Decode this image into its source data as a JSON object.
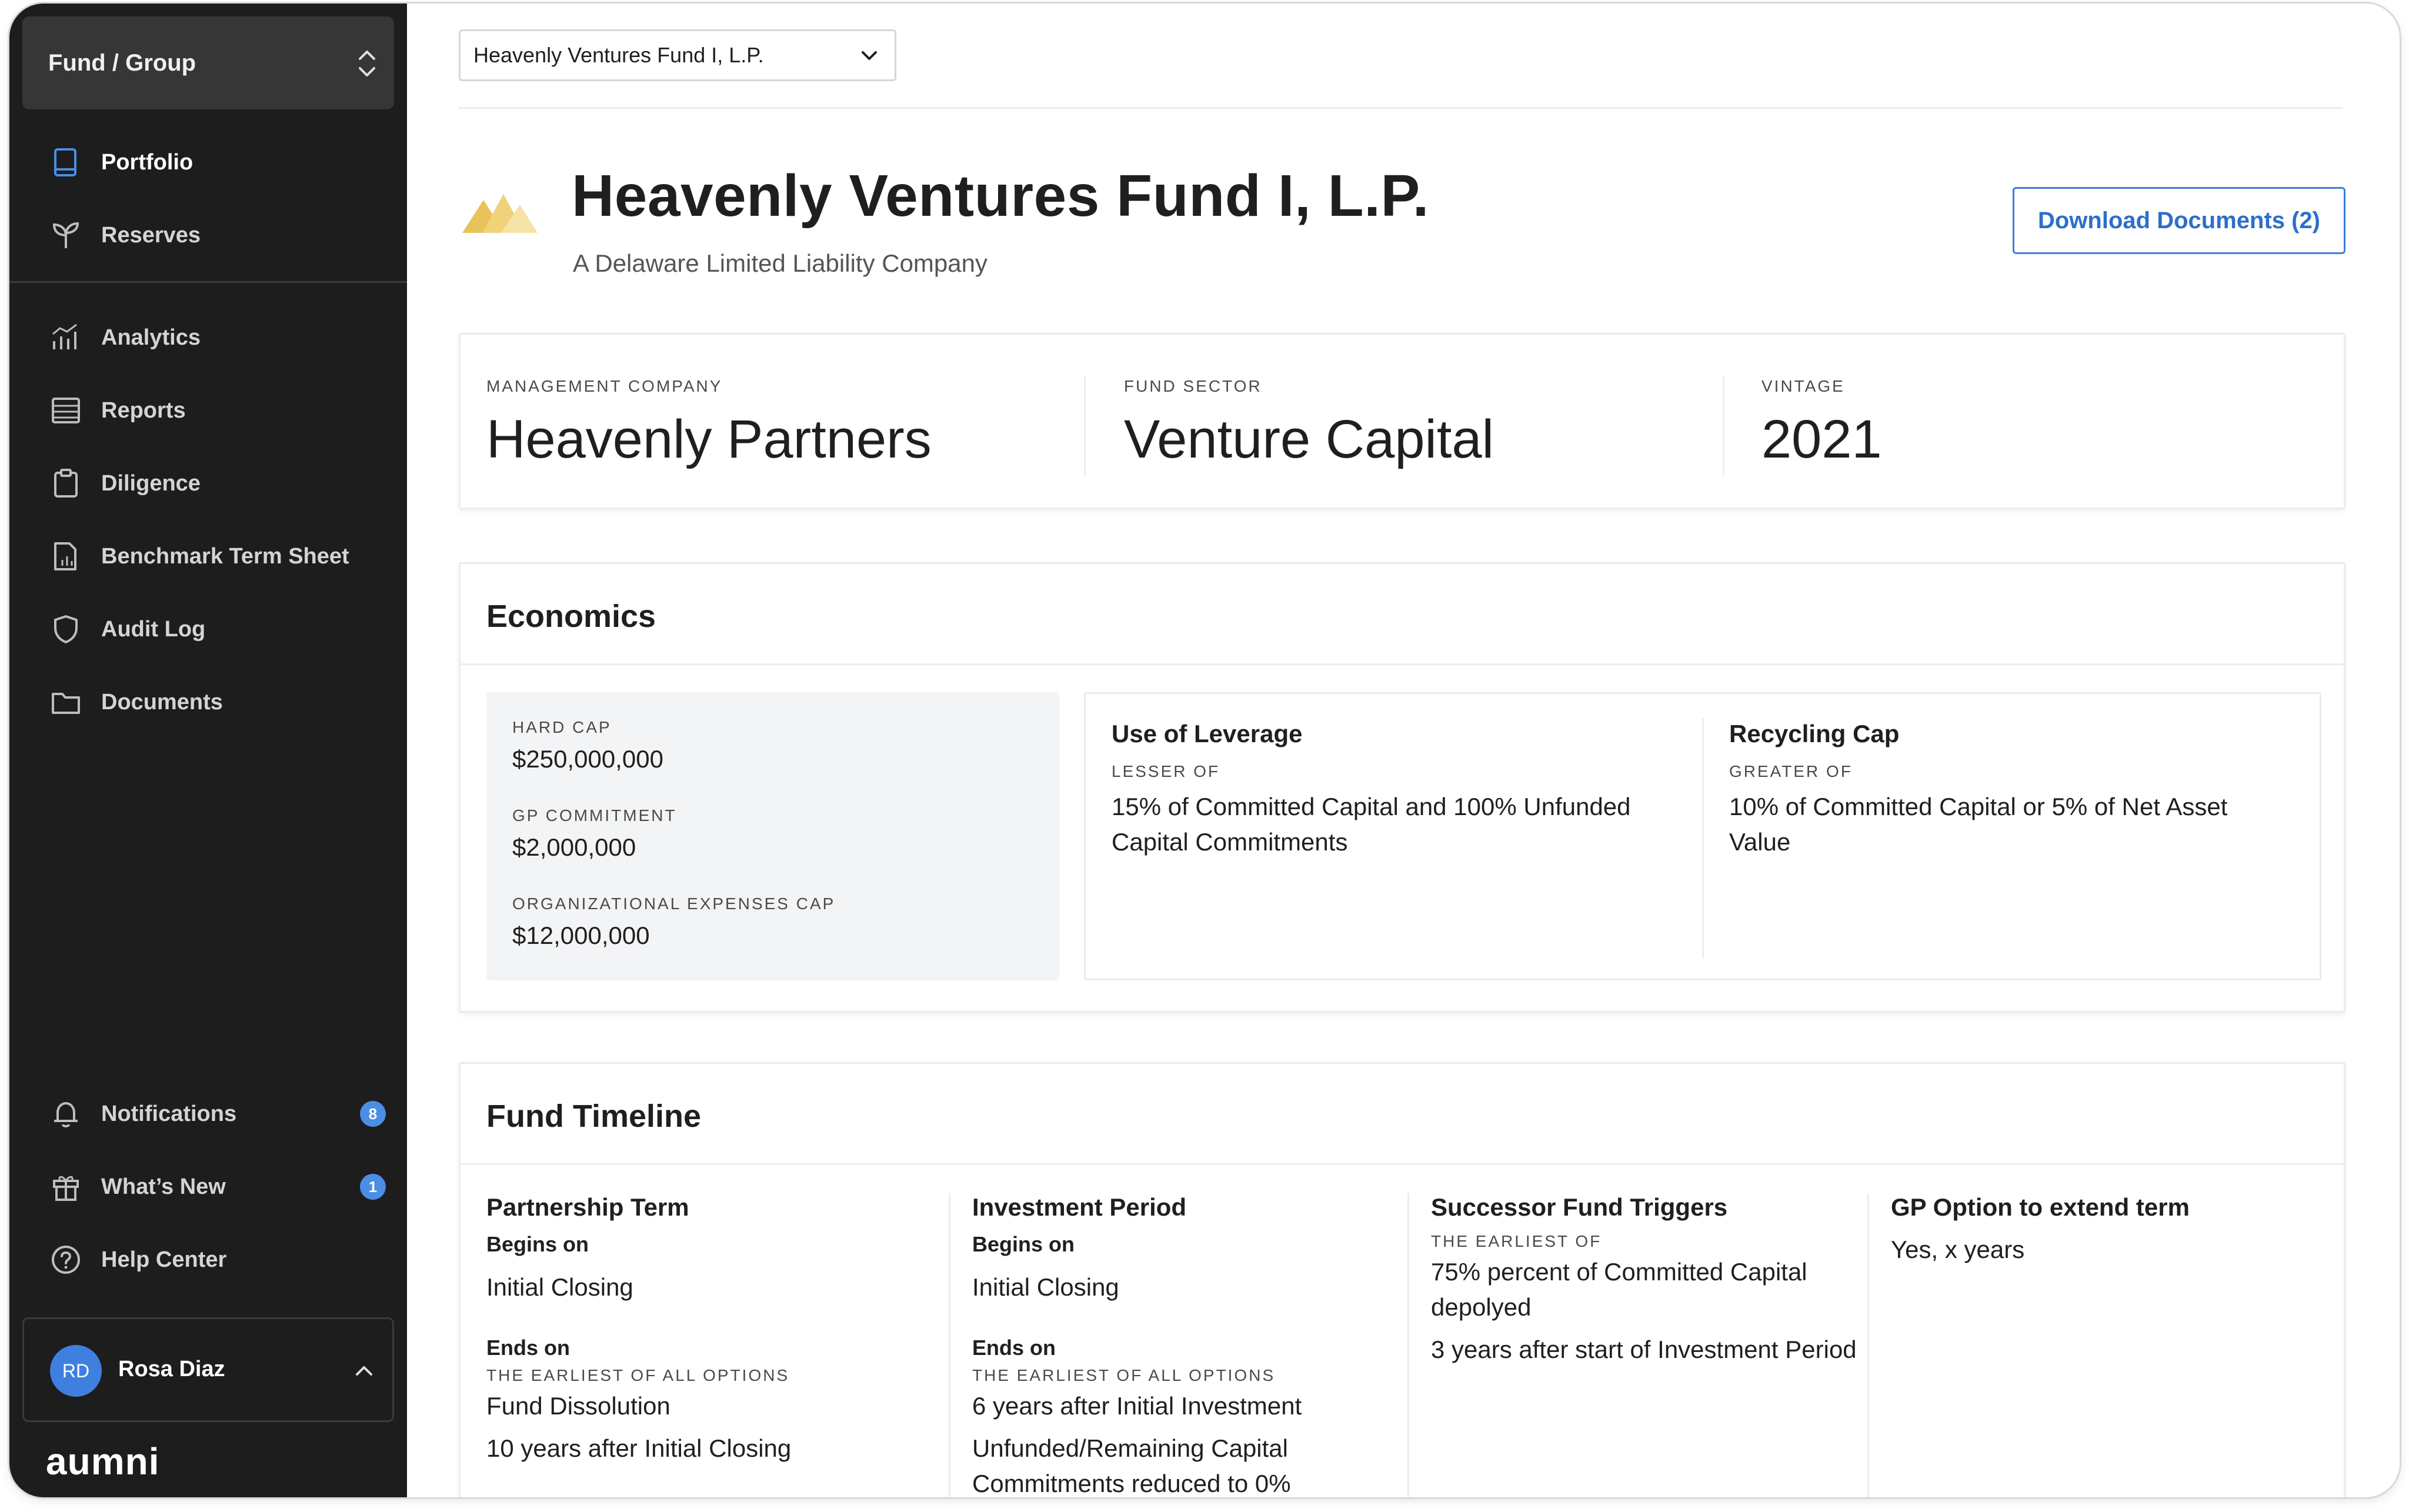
{
  "sidebar": {
    "fund_group_label": "Fund / Group",
    "items": [
      {
        "label": "Portfolio"
      },
      {
        "label": "Reserves"
      },
      {
        "label": "Analytics"
      },
      {
        "label": "Reports"
      },
      {
        "label": "Diligence"
      },
      {
        "label": "Benchmark Term Sheet"
      },
      {
        "label": "Audit Log"
      },
      {
        "label": "Documents"
      }
    ],
    "bottom_items": [
      {
        "label": "Notifications",
        "badge": "8"
      },
      {
        "label": "What’s New",
        "badge": "1"
      },
      {
        "label": "Help Center"
      }
    ],
    "user": {
      "initials": "RD",
      "name": "Rosa Diaz"
    },
    "brand": "aumni"
  },
  "header": {
    "fund_dropdown_value": "Heavenly Ventures Fund I, L.P.",
    "title": "Heavenly Ventures Fund I, L.P.",
    "subtitle": "A Delaware Limited Liability Company",
    "download_label": "Download Documents (2)"
  },
  "summary": {
    "management_company_label": "MANAGEMENT COMPANY",
    "management_company": "Heavenly Partners",
    "fund_sector_label": "FUND SECTOR",
    "fund_sector": "Venture Capital",
    "vintage_label": "VINTAGE",
    "vintage": "2021"
  },
  "economics": {
    "heading": "Economics",
    "hard_cap_label": "HARD CAP",
    "hard_cap": "$250,000,000",
    "gp_commitment_label": "GP COMMITMENT",
    "gp_commitment": "$2,000,000",
    "org_expenses_label": "ORGANIZATIONAL EXPENSES CAP",
    "org_expenses": "$12,000,000",
    "leverage_title": "Use of Leverage",
    "leverage_qualifier": "LESSER OF",
    "leverage_text": "15% of Committed Capital and 100% Unfunded Capital Commitments",
    "recycling_title": "Recycling Cap",
    "recycling_qualifier": "GREATER OF",
    "recycling_text": "10% of Committed Capital or 5% of Net Asset Value"
  },
  "timeline": {
    "heading": "Fund Timeline",
    "partnership": {
      "title": "Partnership Term",
      "begins_label": "Begins on",
      "begins_value": "Initial Closing",
      "ends_label": "Ends on",
      "ends_qualifier": "THE EARLIEST OF ALL OPTIONS",
      "ends_value_1": "Fund Dissolution",
      "ends_value_2": "10 years after Initial Closing"
    },
    "investment": {
      "title": "Investment Period",
      "begins_label": "Begins on",
      "begins_value": "Initial Closing",
      "ends_label": "Ends on",
      "ends_qualifier": "THE EARLIEST OF ALL OPTIONS",
      "ends_value_1": "6 years after Initial Investment",
      "ends_value_2": "Unfunded/Remaining Capital Commitments reduced to 0%"
    },
    "successor": {
      "title": "Successor Fund Triggers",
      "qualifier": "THE EARLIEST OF",
      "value_1": "75% percent of Committed Capital depolyed",
      "value_2": "3 years after start of Investment Period"
    },
    "gp_option": {
      "title": "GP Option to extend term",
      "value": "Yes, x years"
    }
  },
  "colors": {
    "sidebar_bg": "#1d1d1d",
    "accent_blue": "#3b7fd6",
    "badge_blue": "#4a8ee6",
    "logo_gold": "#e8c25a"
  }
}
